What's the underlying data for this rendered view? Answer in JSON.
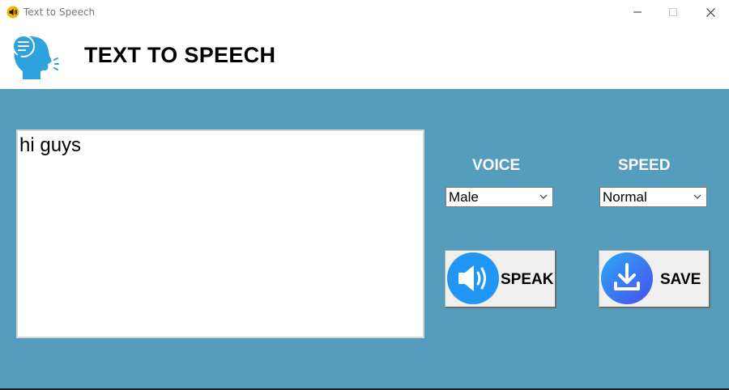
{
  "window": {
    "title": "Text to Speech"
  },
  "header": {
    "title": "TEXT TO SPEECH",
    "icon": "speaking-head-icon"
  },
  "colors": {
    "panel_bg": "#559dbc",
    "icon_blue": "#2196f3",
    "save_gradient": [
      "#2aa9f3",
      "#4b4ef0"
    ]
  },
  "editor": {
    "value": "hi guys"
  },
  "voice": {
    "label": "VOICE",
    "selected": "Male"
  },
  "speed": {
    "label": "SPEED",
    "selected": "Normal"
  },
  "buttons": {
    "speak": {
      "label": "SPEAK",
      "icon": "speaker-icon"
    },
    "save": {
      "label": "SAVE",
      "icon": "download-icon"
    }
  }
}
